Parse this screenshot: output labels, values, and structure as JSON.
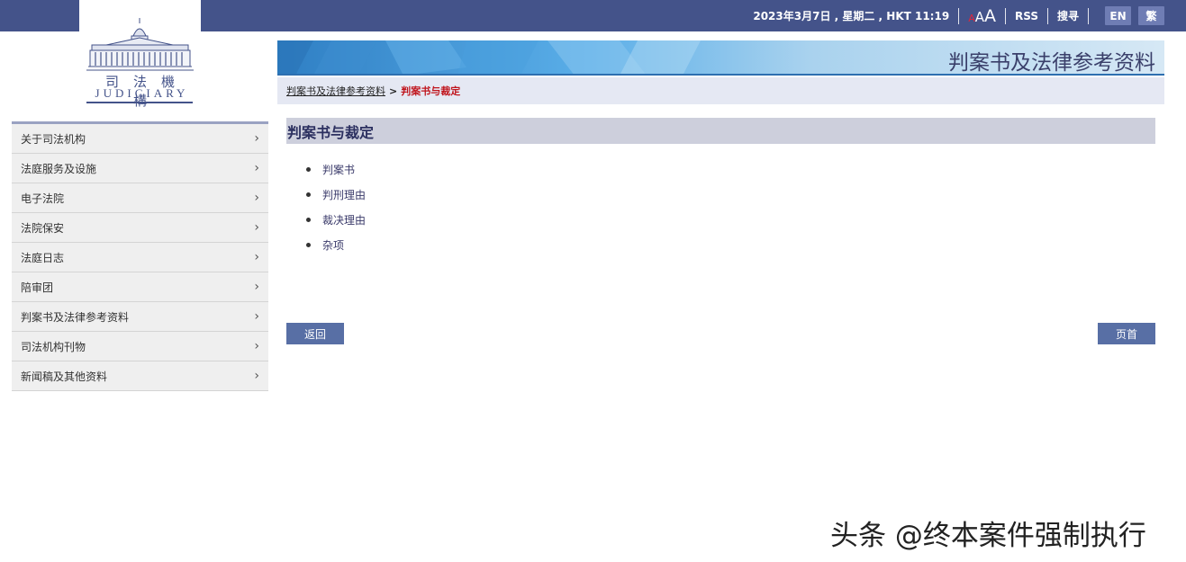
{
  "topbar": {
    "datetime": "2023年3月7日 , 星期二 , HKT 11:19",
    "font_small": "A",
    "font_medium": "A",
    "font_large": "A",
    "rss": "RSS",
    "search": "搜寻",
    "lang_en": "EN",
    "lang_tc": "繁"
  },
  "logo": {
    "cn": "司法機構",
    "en": "JUDICIARY"
  },
  "sidebar": {
    "items": [
      {
        "label": "关于司法机构"
      },
      {
        "label": "法庭服务及设施"
      },
      {
        "label": "电子法院"
      },
      {
        "label": "法院保安"
      },
      {
        "label": "法庭日志"
      },
      {
        "label": "陪审团"
      },
      {
        "label": "判案书及法律参考资料"
      },
      {
        "label": "司法机构刊物"
      },
      {
        "label": "新闻稿及其他资料"
      }
    ]
  },
  "banner": {
    "title": "判案书及法律参考资料"
  },
  "breadcrumb": {
    "parent": "判案书及法律参考资料",
    "separator": ">",
    "current": "判案书与裁定"
  },
  "main": {
    "heading": "判案书与裁定",
    "links": [
      {
        "label": "判案书"
      },
      {
        "label": "判刑理由"
      },
      {
        "label": "裁决理由"
      },
      {
        "label": "杂项"
      }
    ],
    "back_label": "返回",
    "top_label": "页首"
  },
  "watermark": "头条 @终本案件强制执行",
  "colors": {
    "topbar": "#44538a",
    "accent_red": "#c0141c",
    "button": "#586fa5"
  }
}
